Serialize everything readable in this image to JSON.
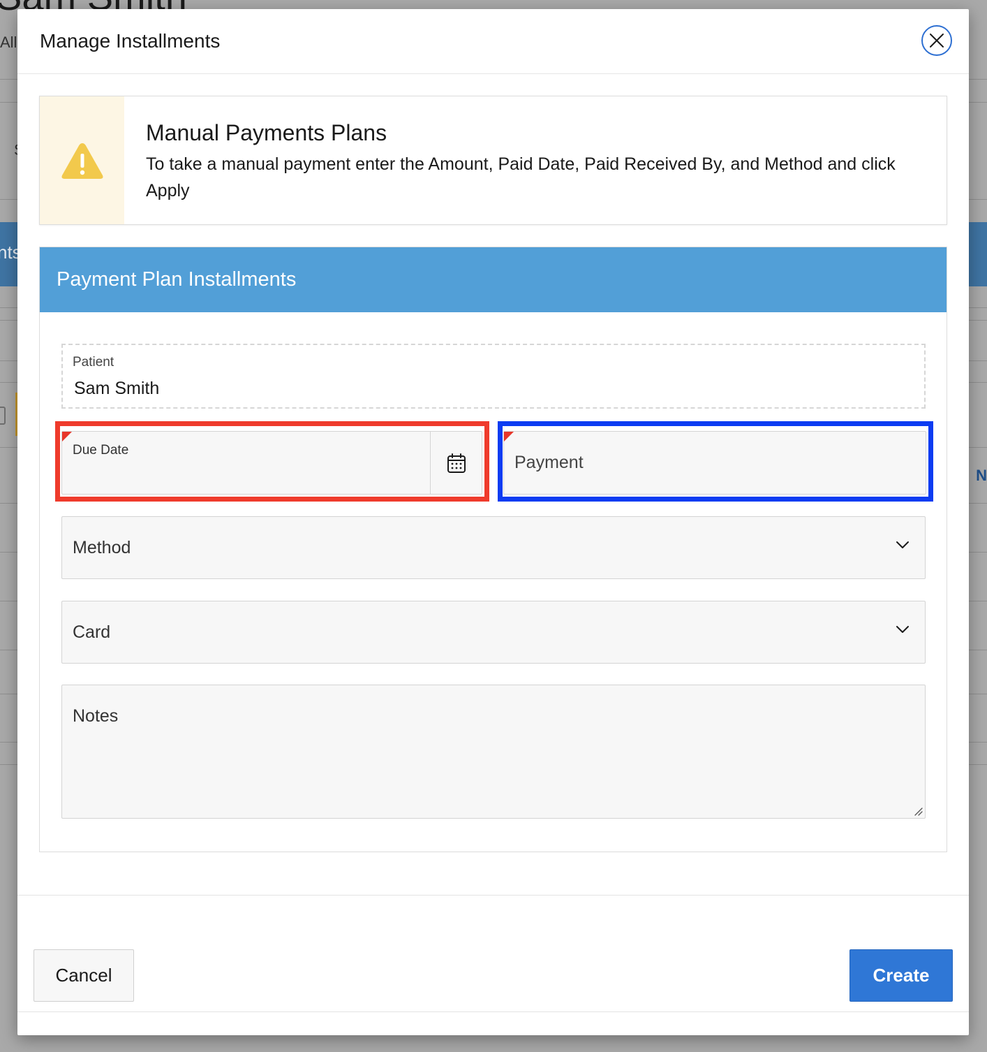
{
  "background": {
    "page_title": "Sam Smith",
    "filter_label": "All",
    "row_initial": "S",
    "band_text": "nts",
    "column_initial": "N"
  },
  "modal": {
    "title": "Manage Installments",
    "close_icon": "close-icon"
  },
  "alert": {
    "icon": "warning-icon",
    "title": "Manual Payments Plans",
    "text": "To take a manual payment enter the Amount, Paid Date, Paid Received By, and Method and click Apply"
  },
  "region": {
    "title": "Payment Plan Installments"
  },
  "form": {
    "patient": {
      "label": "Patient",
      "value": "Sam Smith"
    },
    "due_date": {
      "label": "Due Date",
      "value": "",
      "icon": "calendar-icon"
    },
    "payment": {
      "placeholder": "Payment",
      "value": ""
    },
    "method": {
      "placeholder": "Method",
      "value": ""
    },
    "card": {
      "placeholder": "Card",
      "value": ""
    },
    "notes": {
      "placeholder": "Notes",
      "value": ""
    }
  },
  "footer": {
    "cancel_label": "Cancel",
    "create_label": "Create"
  },
  "colors": {
    "region_header": "#529fd7",
    "primary_button": "#2f77d6",
    "required_marker": "#e8362a",
    "warning": "#f2c94c",
    "highlight_red": "#ef3b2c",
    "highlight_blue": "#0c3cf2"
  }
}
